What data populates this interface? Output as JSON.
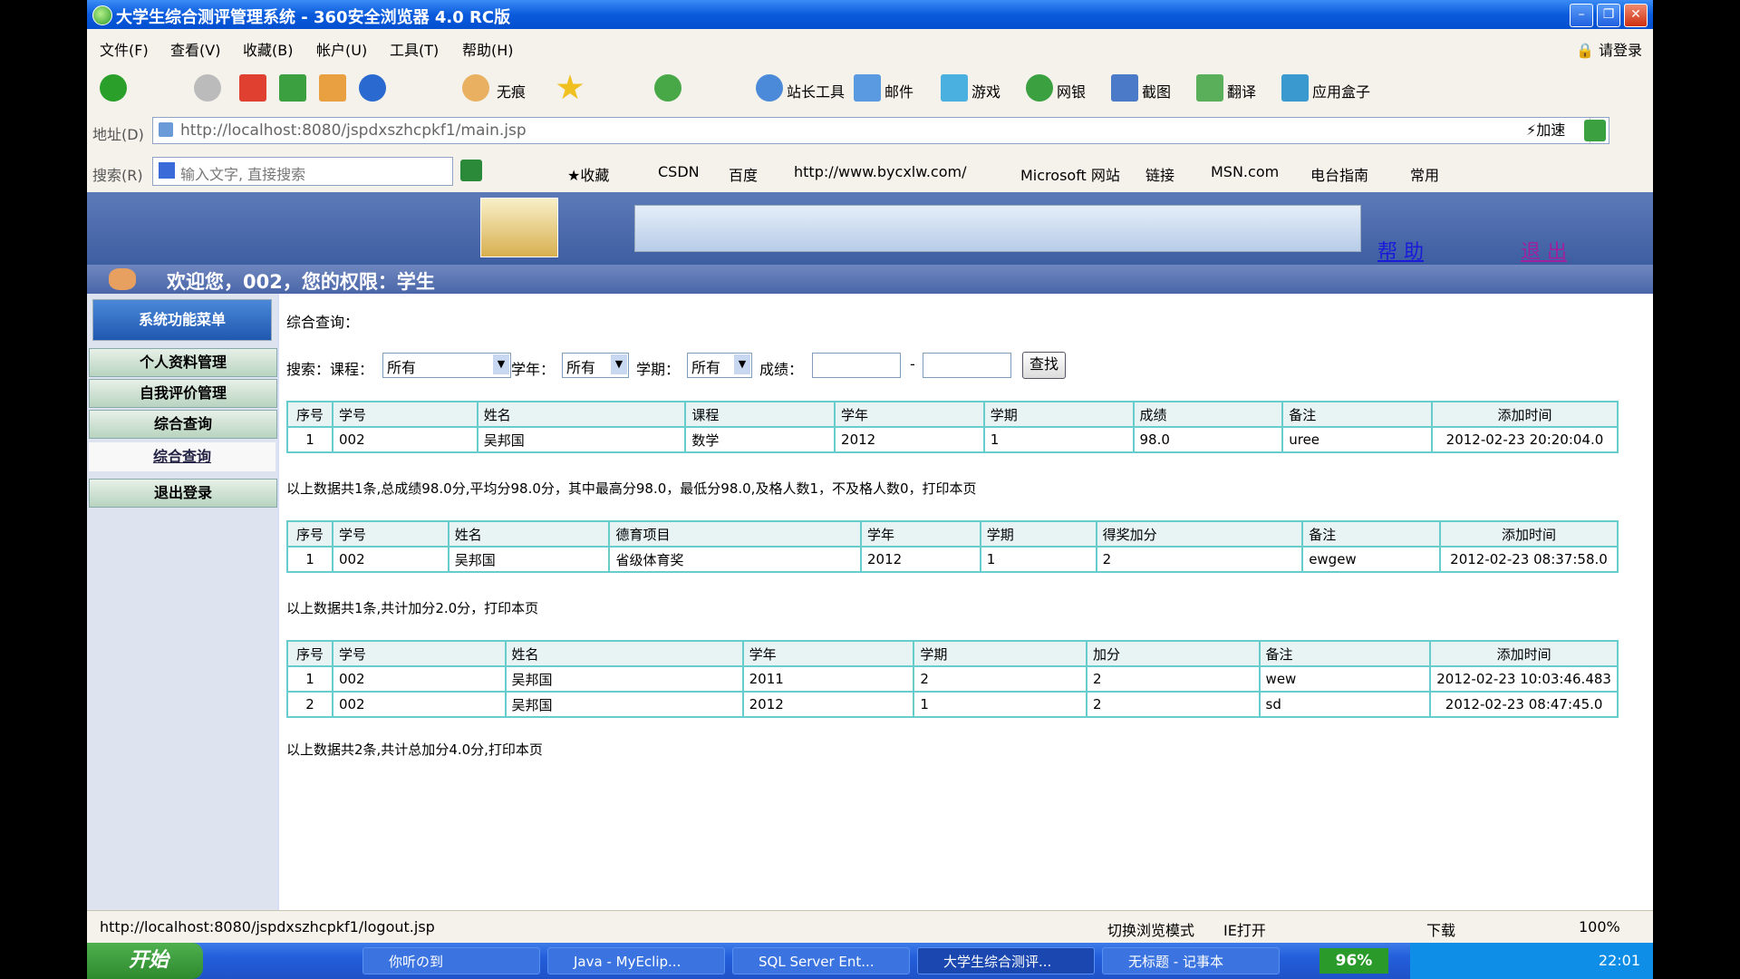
{
  "window": {
    "title": "大学生综合测评管理系统 - 360安全浏览器 4.0 RC版"
  },
  "menu": [
    "文件(F)",
    "查看(V)",
    "收藏(B)",
    "帐户(U)",
    "工具(T)",
    "帮助(H)"
  ],
  "login_label": "请登录",
  "toolbar": {
    "incognito": "无痕",
    "webmaster": "站长工具",
    "mail": "邮件",
    "games": "游戏",
    "netbank": "网银",
    "screenshot": "截图",
    "translate": "翻译",
    "appbox": "应用盒子"
  },
  "address": {
    "label": "地址(D)",
    "url": "http://localhost:8080/jspdxszhcpkf1/main.jsp",
    "speedup": "加速"
  },
  "search": {
    "label": "搜索(R)",
    "placeholder": "输入文字, 直接搜索"
  },
  "favorites": [
    "收藏",
    "CSDN",
    "百度",
    "http://www.bycxlw.com/",
    "Microsoft 网站",
    "链接",
    "MSN.com",
    "电台指南",
    "常用"
  ],
  "header": {
    "help": "帮 助",
    "logout": "退 出"
  },
  "welcome": "欢迎您，002，您的权限：学生",
  "sidebar": {
    "title": "系统功能菜单",
    "items": [
      "个人资料管理",
      "自我评价管理",
      "综合查询"
    ],
    "sub_item": "综合查询",
    "logout": "退出登录"
  },
  "main": {
    "title": "综合查询：",
    "search_label": "搜索：",
    "course_label": "课程：",
    "course_value": "所有",
    "year_label": "学年：",
    "year_value": "所有",
    "term_label": "学期：",
    "term_value": "所有",
    "score_label": "成绩：",
    "dash": "-",
    "find_button": "查找",
    "table1": {
      "headers": [
        "序号",
        "学号",
        "姓名",
        "课程",
        "学年",
        "学期",
        "成绩",
        "备注",
        "添加时间"
      ],
      "rows": [
        [
          "1",
          "002",
          "吴邦国",
          "数学",
          "2012",
          "1",
          "98.0",
          "uree",
          "2012-02-23 20:20:04.0"
        ]
      ],
      "summary": "以上数据共1条,总成绩98.0分,平均分98.0分，其中最高分98.0，最低分98.0,及格人数1，不及格人数0，打印本页"
    },
    "table2": {
      "headers": [
        "序号",
        "学号",
        "姓名",
        "德育项目",
        "学年",
        "学期",
        "得奖加分",
        "备注",
        "添加时间"
      ],
      "rows": [
        [
          "1",
          "002",
          "吴邦国",
          "省级体育奖",
          "2012",
          "1",
          "2",
          "ewgew",
          "2012-02-23 08:37:58.0"
        ]
      ],
      "summary": "以上数据共1条,共计加分2.0分，打印本页"
    },
    "table3": {
      "headers": [
        "序号",
        "学号",
        "姓名",
        "学年",
        "学期",
        "加分",
        "备注",
        "添加时间"
      ],
      "rows": [
        [
          "1",
          "002",
          "吴邦国",
          "2011",
          "2",
          "2",
          "wew",
          "2012-02-23 10:03:46.483"
        ],
        [
          "2",
          "002",
          "吴邦国",
          "2012",
          "1",
          "2",
          "sd",
          "2012-02-23 08:47:45.0"
        ]
      ],
      "summary": "以上数据共2条,共计总加分4.0分,打印本页"
    }
  },
  "statusbar": {
    "url": "http://localhost:8080/jspdxszhcpkf1/logout.jsp",
    "switch_mode": "切换浏览模式",
    "ie_open": "IE打开",
    "download": "下载",
    "zoom": "100%"
  },
  "taskbar": {
    "start": "开始",
    "tasks": [
      "你听の到",
      "Java - MyEclip...",
      "SQL Server Ent...",
      "大学生综合测评...",
      "无标题 - 记事本"
    ],
    "battery": "96%",
    "clock": "22:01"
  }
}
